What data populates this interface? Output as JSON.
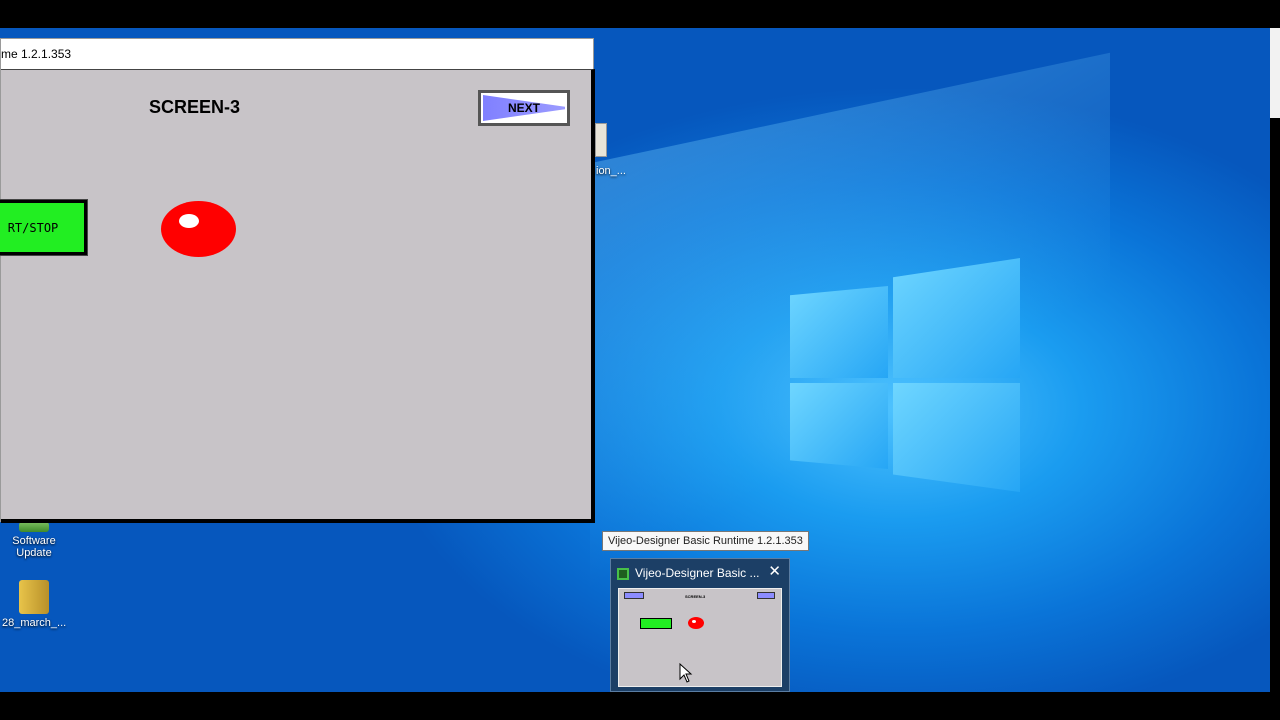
{
  "runtime_window": {
    "title": "me 1.2.1.353",
    "screen_title": "SCREEN-3",
    "next_label": "NEXT",
    "startstop_label": "RT/STOP"
  },
  "desktop": {
    "icons": [
      {
        "label_line1": "Software",
        "label_line2": "Update"
      },
      {
        "label_line1": "28_march_...",
        "label_line2": ""
      }
    ],
    "partial_label": "ion_..."
  },
  "taskbar_preview": {
    "tooltip": "Vijeo-Designer Basic Runtime 1.2.1.353",
    "title": "Vijeo-Designer Basic ...",
    "close_glyph": "✕",
    "thumb_title": "SCREEN-3"
  },
  "colors": {
    "hmi_bg": "#c8c4c8",
    "button_green": "#22ee22",
    "lamp_red": "#ff0000",
    "next_blue": "#8080ff"
  }
}
